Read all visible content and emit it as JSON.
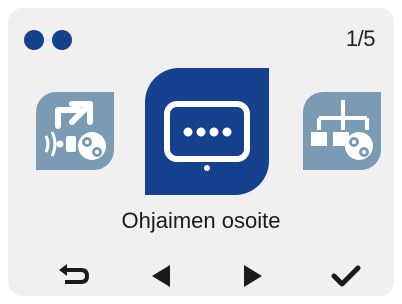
{
  "header": {
    "page_indicator": "1/5"
  },
  "carousel": {
    "current_label": "Ohjaimen osoite",
    "items": [
      {
        "icon": "remote-config-gear-icon"
      },
      {
        "icon": "display-dots-icon"
      },
      {
        "icon": "network-tree-gear-icon"
      }
    ]
  },
  "controls": {
    "back": "back-arrow-icon",
    "prev": "triangle-left-icon",
    "next": "triangle-right-icon",
    "ok": "checkmark-icon"
  },
  "colors": {
    "accent": "#15418f",
    "tile_muted": "#7a9bb3",
    "background": "#f0f0f0",
    "text": "#1a1a1a"
  }
}
